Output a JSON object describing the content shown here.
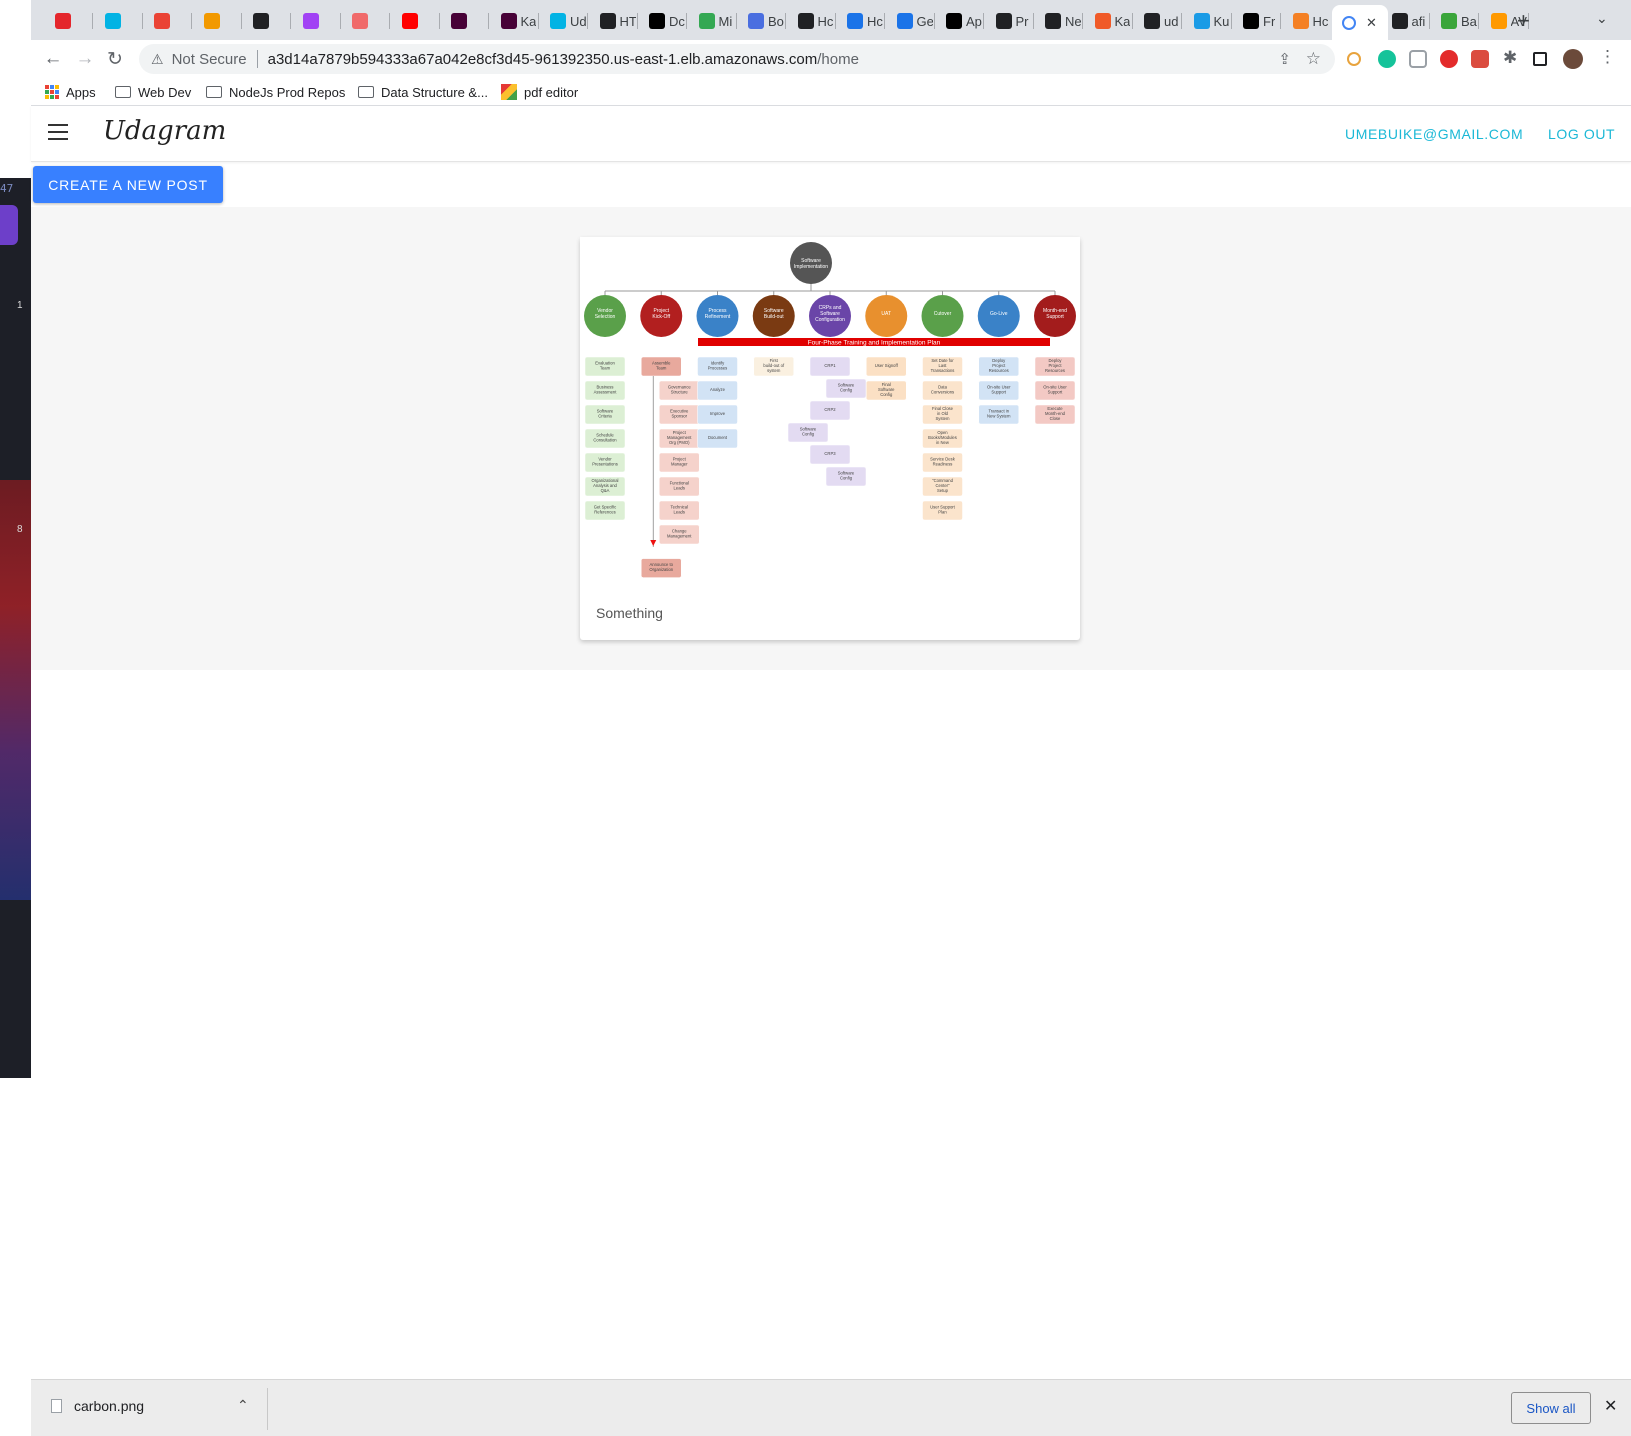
{
  "browser": {
    "tabs": [
      {
        "icon": "airtel-icon",
        "label": "",
        "color": "#e4262c"
      },
      {
        "icon": "udacity-icon",
        "label": "",
        "color": "#02b3e4"
      },
      {
        "icon": "gmail-icon",
        "label": "",
        "color": "#ea4335"
      },
      {
        "icon": "back-arrow-icon",
        "label": "",
        "color": "#f29900"
      },
      {
        "icon": "q-icon",
        "label": "",
        "color": "#202124"
      },
      {
        "icon": "u-circle-icon",
        "label": "",
        "color": "#a142f4"
      },
      {
        "icon": "asana-icon",
        "label": "",
        "color": "#f06a6a"
      },
      {
        "icon": "youtube-icon",
        "label": "",
        "color": "#ff0000"
      },
      {
        "icon": "xd-icon",
        "label": "",
        "color": "#470137"
      },
      {
        "icon": "xd-icon",
        "label": "Ka",
        "color": "#470137"
      },
      {
        "icon": "udacity-icon",
        "label": "Ud",
        "color": "#02b3e4"
      },
      {
        "icon": "globe-icon",
        "label": "HT",
        "color": "#202124"
      },
      {
        "icon": "dev-icon",
        "label": "Dc",
        "color": "#000000"
      },
      {
        "icon": "smiley-icon",
        "label": "Mi",
        "color": "#34a853"
      },
      {
        "icon": "ac-icon",
        "label": "Bo",
        "color": "#4a6ee0"
      },
      {
        "icon": "globe-icon",
        "label": "Hc",
        "color": "#202124"
      },
      {
        "icon": "diamond-icon",
        "label": "Hc",
        "color": "#1a73e8"
      },
      {
        "icon": "diamond-icon",
        "label": "Ge",
        "color": "#1a73e8"
      },
      {
        "icon": "seven-icon",
        "label": "Ap",
        "color": "#000000"
      },
      {
        "icon": "p-icon",
        "label": "Pr",
        "color": "#202124"
      },
      {
        "icon": "ne-icon",
        "label": "Ne",
        "color": "#202124"
      },
      {
        "icon": "ka-icon",
        "label": "Ka",
        "color": "#f05a28"
      },
      {
        "icon": "github-icon",
        "label": "ud",
        "color": "#202124"
      },
      {
        "icon": "ku-icon",
        "label": "Ku",
        "color": "#1a9be6"
      },
      {
        "icon": "medium-icon",
        "label": "Fr",
        "color": "#000000"
      },
      {
        "icon": "stack-icon",
        "label": "Hc",
        "color": "#f48024"
      },
      {
        "icon": "chrome-loading-icon",
        "label": "",
        "color": "#4285f4",
        "active": true
      },
      {
        "icon": "globe-icon",
        "label": "afi",
        "color": "#202124"
      },
      {
        "icon": "b64-icon",
        "label": "Ba",
        "color": "#3aa53a"
      },
      {
        "icon": "aws-icon",
        "label": "AV",
        "color": "#ff9900"
      }
    ],
    "address": {
      "security_label": "Not Secure",
      "host": "a3d14a7879b594333a67a042e8cf3d45-961392350.us-east-1.elb.amazonaws.com",
      "path": "/home"
    },
    "bookmarks": [
      {
        "label": "Apps",
        "icon": "apps-grid-icon"
      },
      {
        "label": "Web Dev",
        "icon": "folder-icon"
      },
      {
        "label": "NodeJs Prod Repos",
        "icon": "folder-icon"
      },
      {
        "label": "Data Structure &...",
        "icon": "folder-icon"
      },
      {
        "label": "pdf editor",
        "icon": "pdf-editor-icon"
      }
    ]
  },
  "desktop": {
    "num_a": "47",
    "num_b": "1",
    "num_c": "8"
  },
  "app": {
    "brand": "Udagram",
    "user_email": "UMEBUIKE@GMAIL.COM",
    "logout_label": "LOG OUT",
    "create_label": "CREATE A NEW POST",
    "accent": "#1bb8d6",
    "button_color": "#3880ff",
    "feed": [
      {
        "caption": "Something",
        "image": {
          "root": "Software Implementation",
          "banner": "Four-Phase Training and Implementation Plan",
          "phases": [
            {
              "name": "Vendor Selection",
              "color": "#5aa04a",
              "items": [
                "Evaluation Team",
                "Business Assessment",
                "Software Criteria",
                "Schedule Consultation",
                "Vendor Presentations",
                "Organizational Analysis and Q&A",
                "Get Specific References"
              ]
            },
            {
              "name": "Project Kick-Off",
              "color": "#b21f1f",
              "items": [
                "Assemble Team",
                "Governance Structure",
                "Executive Sponsor",
                "Project Management Org (PMO)",
                "Project Manager",
                "Functional Leads",
                "Technical Leads",
                "Change Management",
                "Announce to Organization"
              ]
            },
            {
              "name": "Process Refinement",
              "color": "#3a82c8",
              "items": [
                "Identify Processes",
                "Analyze",
                "Improve",
                "Document"
              ]
            },
            {
              "name": "Software Build-out",
              "color": "#7a3a12",
              "items": [
                "First build-out of system"
              ]
            },
            {
              "name": "CRPs and Software Configuration",
              "color": "#6a45a8",
              "items": [
                "CRP1",
                "Software Config",
                "CRP2",
                "Software Config",
                "CRP3",
                "Software Config"
              ]
            },
            {
              "name": "UAT",
              "color": "#e8902e",
              "items": [
                "User Signoff",
                "Final Software Config"
              ]
            },
            {
              "name": "Cutover",
              "color": "#5aa04a",
              "items": [
                "Set Date for Last Transactions",
                "Data Conversions",
                "Final Close in Old System",
                "Open Books/Modules in New System",
                "Service Desk Readiness",
                "\"Command Center\" Setup",
                "User Support Plan"
              ]
            },
            {
              "name": "Go-Live",
              "color": "#3a82c8",
              "items": [
                "Deploy Project Resources",
                "On-site User Support",
                "Transact in New System"
              ]
            },
            {
              "name": "Month-end Support",
              "color": "#a31c1c",
              "items": [
                "Deploy Project Resources",
                "On-site User Support",
                "Execute Month-end Close Process"
              ]
            }
          ]
        }
      }
    ]
  },
  "downloads": {
    "file_name": "carbon.png",
    "show_all_label": "Show all"
  }
}
